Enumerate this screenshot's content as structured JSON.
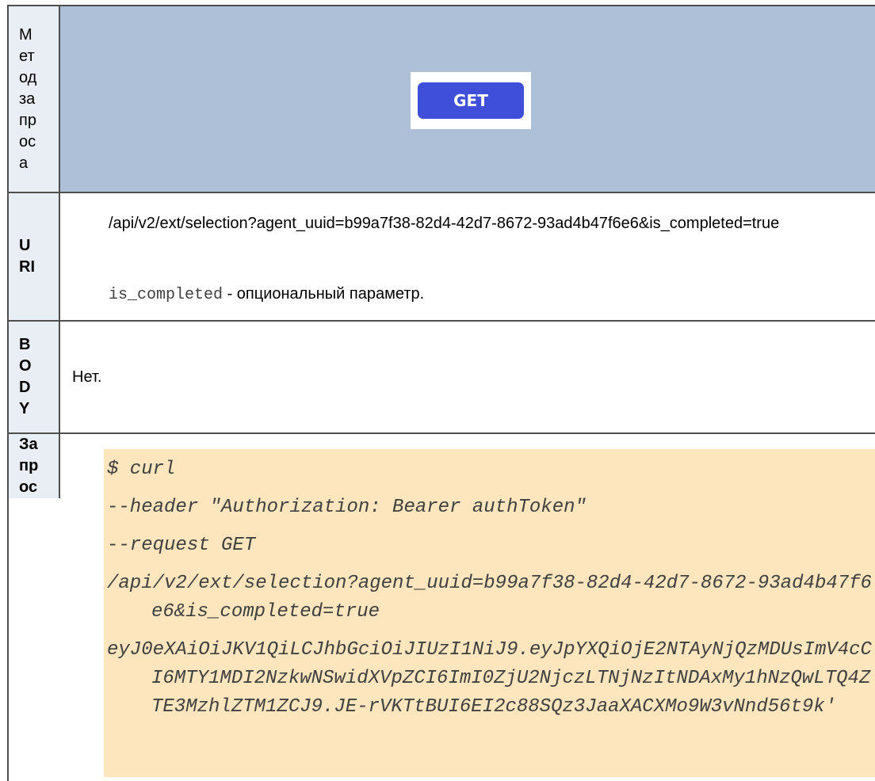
{
  "method_row": {
    "label_lines": [
      "М",
      "ет",
      "од",
      "за",
      "пр",
      "ос",
      "а"
    ],
    "method": "GET",
    "colors": {
      "header_bg": "#adc0d8",
      "badge": "#3f4fd9",
      "label_bg": "#e9edf4"
    }
  },
  "uri_row": {
    "label_lines": [
      "U",
      "RI"
    ],
    "uri": "/api/v2/ext/selection?agent_uuid=b99a7f38-82d4-42d7-8672-93ad4b47f6e6&is_completed=true",
    "note_param": "is_completed",
    "note_text": " - опциональный параметр."
  },
  "body_row": {
    "label_lines": [
      "B",
      "O",
      "D",
      "Y"
    ],
    "text": "Нет."
  },
  "request_row": {
    "label_lines": [
      "За",
      "пр",
      "ос"
    ],
    "code_lines": [
      "$ curl",
      "--header \"Authorization: Bearer authToken\"",
      "--request GET",
      "/api/v2/ext/selection?agent_uuid=b99a7f38-82d4-42d7-8672-93ad4b47f6e6&is_completed=true",
      "eyJ0eXAiOiJKV1QiLCJhbGciOiJIUzI1NiJ9.eyJpYXQiOjE2NTAyNjQzMDUsImV4cCI6MTY1MDI2NzkwNSwidXVpZCI6ImI0ZjU2NjczLTNjNzItNDAxMy1hNzQwLTQ4ZTE3MzhlZTM1ZCJ9.JE-rVKTtBUI6EI2c88SQz3JaaXACXMo9W3vNnd56t9k'"
    ],
    "colors": {
      "code_bg": "#fde5bd"
    }
  }
}
